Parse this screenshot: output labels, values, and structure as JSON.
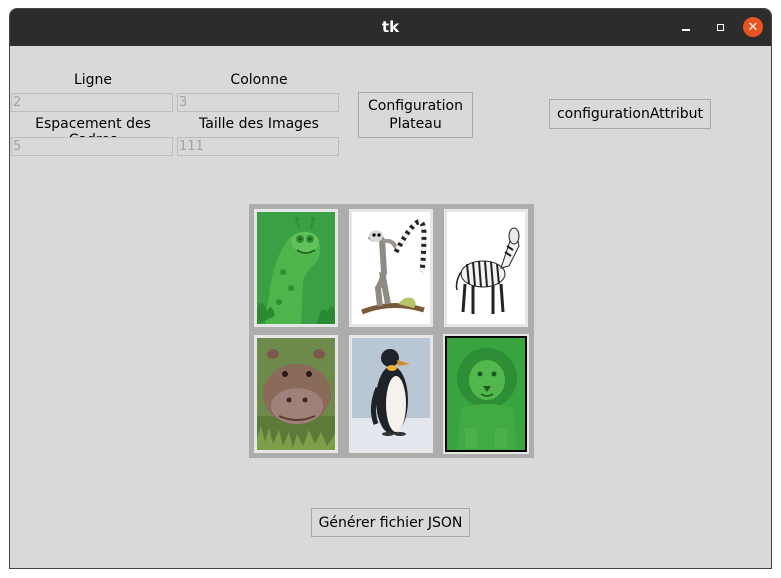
{
  "window": {
    "title": "tk"
  },
  "form": {
    "ligne_label": "Ligne",
    "ligne_value": "2",
    "colonne_label": "Colonne",
    "colonne_value": "3",
    "espacement_label": "Espacement des Cadres",
    "espacement_value": "5",
    "taille_label": "Taille des Images",
    "taille_value": "111"
  },
  "buttons": {
    "config_plateau_line1": "Configuration",
    "config_plateau_line2": "Plateau",
    "config_attribut": "configurationAttribut",
    "generate_json": "Générer fichier JSON"
  },
  "board": {
    "rows": 2,
    "columns": 3,
    "cards": [
      {
        "animal": "giraffe",
        "tinted": true,
        "selected": false
      },
      {
        "animal": "lemur",
        "tinted": false,
        "selected": false
      },
      {
        "animal": "zebra",
        "tinted": false,
        "selected": false
      },
      {
        "animal": "hippo",
        "tinted": false,
        "selected": false
      },
      {
        "animal": "penguin",
        "tinted": false,
        "selected": false
      },
      {
        "animal": "lion",
        "tinted": true,
        "selected": true
      }
    ]
  },
  "colors": {
    "titlebar": "#2c2c2c",
    "window_bg": "#d9d9d9",
    "close_button": "#e95420",
    "green_tint": "#2db52d"
  },
  "icons": {
    "minimize": "minimize-icon",
    "maximize": "maximize-icon",
    "close": "close-icon"
  }
}
